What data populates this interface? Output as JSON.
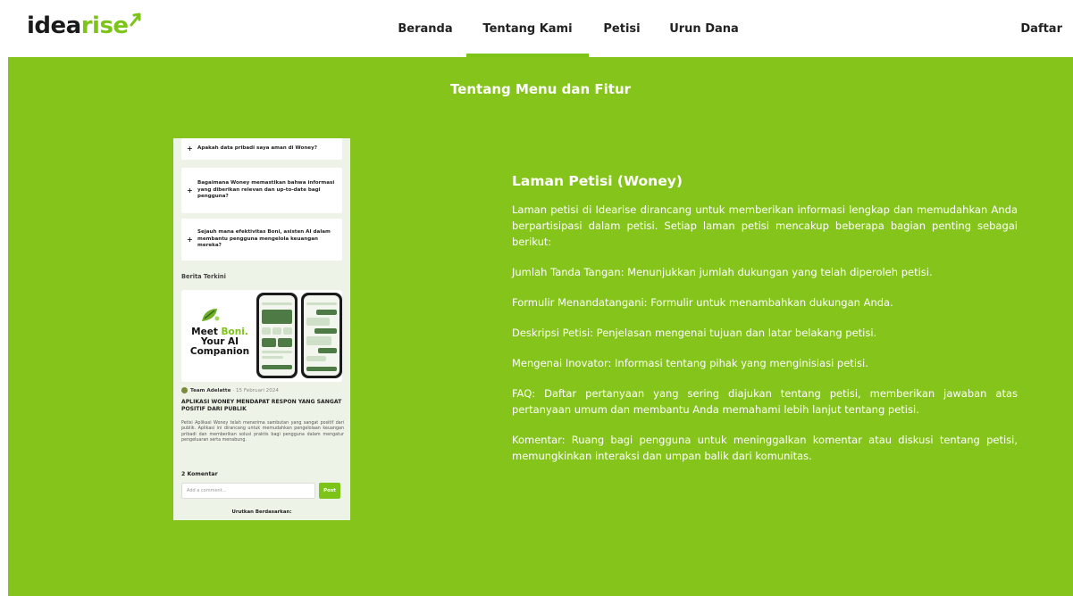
{
  "header": {
    "logo_idea": "idea",
    "logo_rise": "rise",
    "nav": [
      {
        "label": "Beranda",
        "active": false
      },
      {
        "label": "Tentang Kami",
        "active": true
      },
      {
        "label": "Petisi",
        "active": false
      },
      {
        "label": "Urun Dana",
        "active": false
      }
    ],
    "signup_label": "Daftar"
  },
  "section": {
    "title": "Tentang Menu dan Fitur"
  },
  "preview": {
    "faq": [
      "Apakah data pribadi saya aman di Woney?",
      "Bagaimana Woney memastikan bahwa informasi yang diberikan relevan dan up-to-date bagi pengguna?",
      "Sejauh mana efektivitas Boni, asisten AI dalam membantu pengguna mengelola keuangan mereka?"
    ],
    "news_heading": "Berita Terkini",
    "banner": {
      "line1_a": "Meet ",
      "line1_b": "Boni.",
      "line2": "Your AI",
      "line3": "Companion"
    },
    "author_name": "Team Adelatte",
    "author_date": "· 15 Februari 2024",
    "article_title": "APLIKASI WONEY MENDAPAT RESPON YANG SANGAT POSITIF DARI PUBLIK",
    "article_body": "Petisi Aplikasi Woney telah menerima sambutan yang sangat positif dari publik. Aplikasi ini dirancang untuk memudahkan pengelolaan keuangan pribadi dan memberikan solusi praktis bagi pengguna dalam mengatur pengeluaran serta menabung.",
    "comments_heading": "2 Komentar",
    "comment_placeholder": "Add a comment...",
    "post_label": "Post",
    "sort_label": "Urutkan Berdasarkan:"
  },
  "description": {
    "title": "Laman Petisi (Woney)",
    "paragraphs": [
      "Laman petisi di Idearise dirancang untuk memberikan informasi lengkap dan memudahkan Anda berpartisipasi dalam petisi. Setiap laman petisi mencakup beberapa bagian penting sebagai berikut:",
      "Jumlah Tanda Tangan: Menunjukkan jumlah dukungan yang telah diperoleh petisi.",
      "Formulir Menandatangani: Formulir untuk menambahkan dukungan Anda.",
      "Deskripsi Petisi: Penjelasan mengenai tujuan dan latar belakang petisi.",
      "Mengenai Inovator: Informasi tentang pihak yang menginisiasi petisi.",
      "FAQ: Daftar pertanyaan yang sering diajukan tentang petisi, memberikan jawaban atas pertanyaan umum dan membantu Anda memahami lebih lanjut tentang petisi.",
      "Komentar: Ruang bagi pengguna untuk meninggalkan komentar atau diskusi tentang petisi, memungkinkan interaksi dan umpan balik dari komunitas."
    ]
  },
  "colors": {
    "brand_green": "#85c41a",
    "accent_green": "#7cc418"
  }
}
